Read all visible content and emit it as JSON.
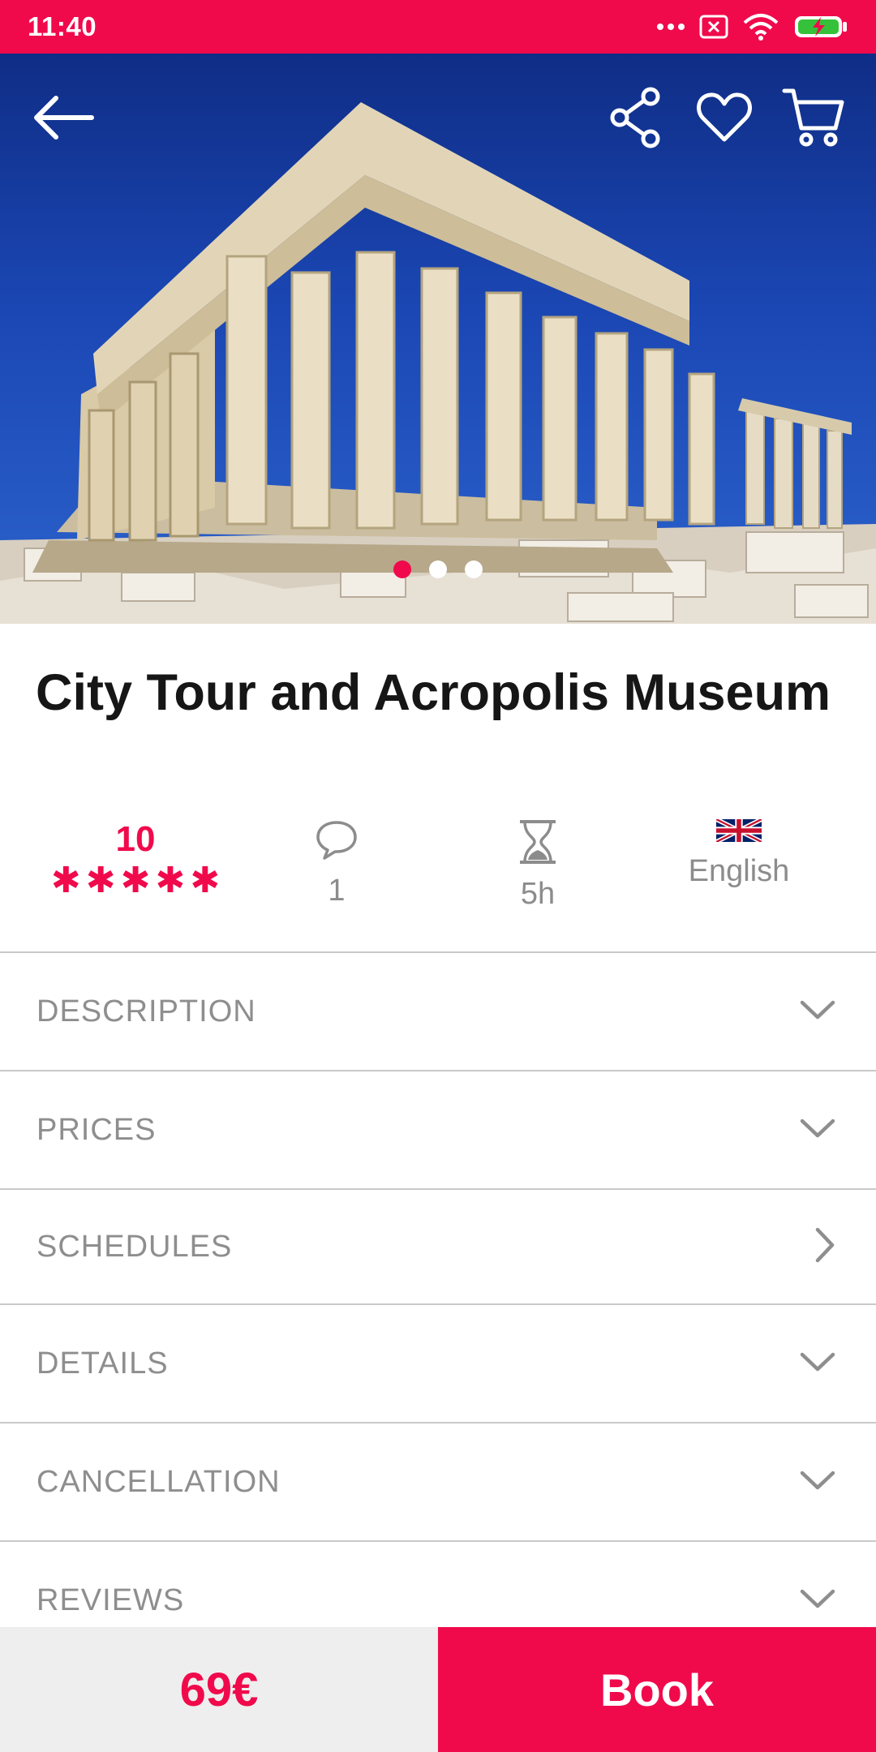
{
  "status_bar": {
    "time": "11:40",
    "icons": [
      "more-dots-icon",
      "notification-x-icon",
      "wifi-icon",
      "battery-charging-icon"
    ]
  },
  "hero": {
    "icons": [
      "back-arrow-icon",
      "share-icon",
      "heart-icon",
      "cart-icon"
    ],
    "carousel": {
      "total": 3,
      "active_index": 0
    }
  },
  "tour": {
    "title": "City Tour and Acropolis Museum"
  },
  "stats": {
    "rating": "10",
    "stars": 5,
    "comments": "1",
    "duration": "5h",
    "language": "English"
  },
  "sections": [
    {
      "label": "DESCRIPTION",
      "icon": "chevron-down-icon"
    },
    {
      "label": "PRICES",
      "icon": "chevron-down-icon"
    },
    {
      "label": "SCHEDULES",
      "icon": "chevron-right-icon"
    },
    {
      "label": "DETAILS",
      "icon": "chevron-down-icon"
    },
    {
      "label": "CANCELLATION",
      "icon": "chevron-down-icon"
    },
    {
      "label": "REVIEWS",
      "icon": "chevron-down-icon"
    }
  ],
  "bottom_bar": {
    "price": "69€",
    "book_label": "Book"
  },
  "colors": {
    "brand": "#f00a4c",
    "text_muted": "#8e8e8e",
    "title": "#161616"
  }
}
